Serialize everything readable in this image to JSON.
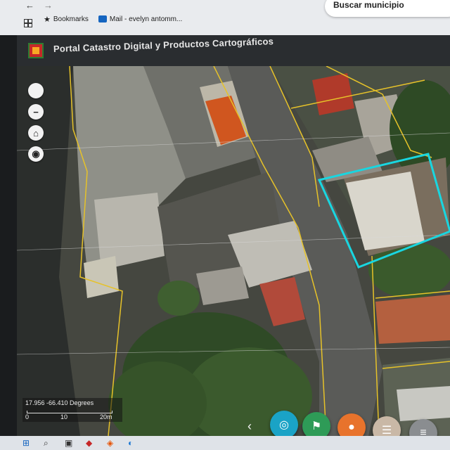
{
  "browser": {
    "bookmarks": [
      {
        "label": "Bookmarks",
        "icon": "star-icon"
      },
      {
        "label": "Mail - evelyn antomm...",
        "icon": "mail-icon"
      }
    ],
    "search_label": "Buscar municipio"
  },
  "app": {
    "title": "Portal Catastro Digital y Productos Cartográficos"
  },
  "map": {
    "controls": [
      "zoom-out",
      "home",
      "locate"
    ],
    "coordinates": "17.956 -66.410 Degrees",
    "scale_labels": [
      "0",
      "10",
      "20m"
    ]
  },
  "toolbar": {
    "buttons": [
      {
        "name": "binoculars-button",
        "color": "#1aa3c6"
      },
      {
        "name": "flag-button",
        "color": "#2e9b57"
      },
      {
        "name": "palette-button",
        "color": "#e8732c"
      },
      {
        "name": "layers-button",
        "color": "#c9b8a6"
      },
      {
        "name": "list-button",
        "color": "#8a8d90"
      }
    ]
  },
  "colors": {
    "parcel_line": "#e6c229",
    "selection": "#19d6e0"
  }
}
